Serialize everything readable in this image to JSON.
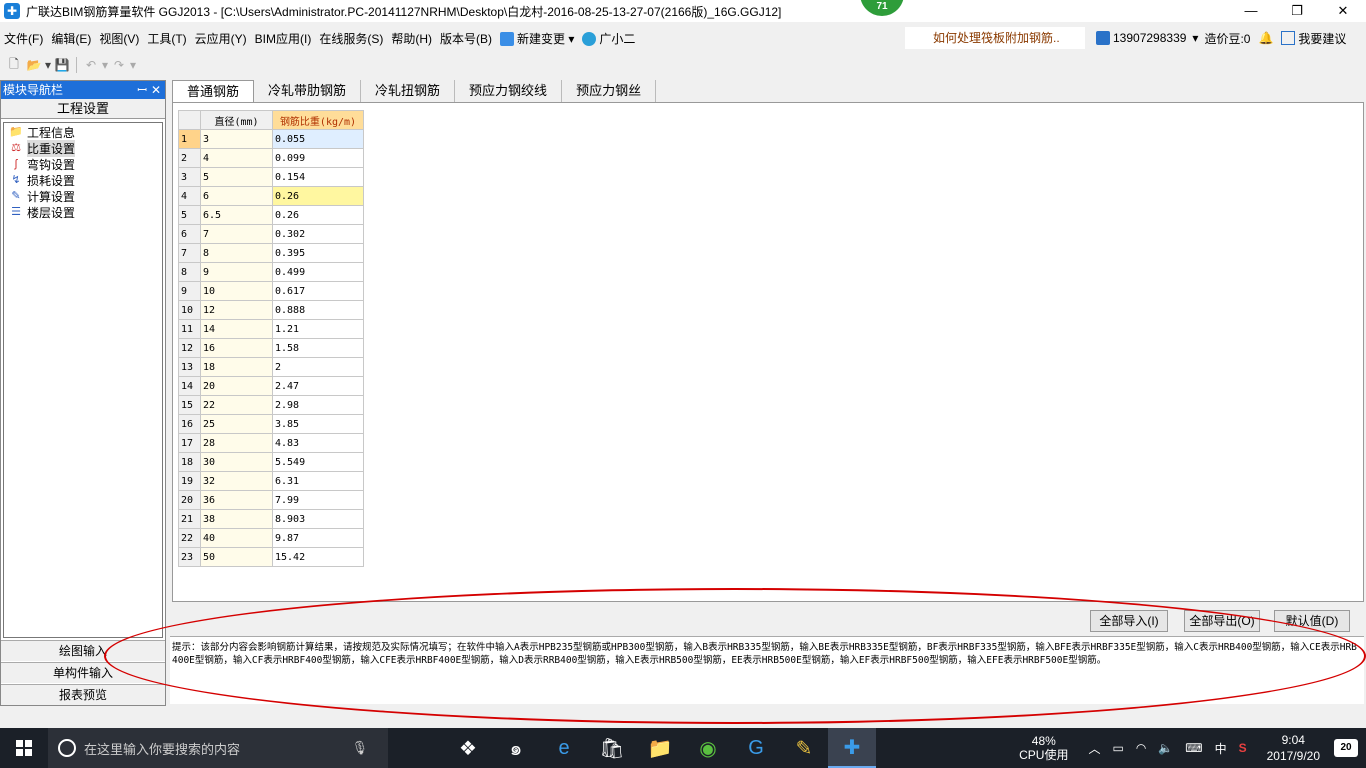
{
  "window": {
    "title": "广联达BIM钢筋算量软件 GGJ2013 - [C:\\Users\\Administrator.PC-20141127NRHM\\Desktop\\白龙村-2016-08-25-13-27-07(2166版)_16G.GGJ12]",
    "badge": "71",
    "minimize": "—",
    "maximize": "❐",
    "close": "✕"
  },
  "menu": {
    "items": [
      "文件(F)",
      "编辑(E)",
      "视图(V)",
      "工具(T)",
      "云应用(Y)",
      "BIM应用(I)",
      "在线服务(S)",
      "帮助(H)",
      "版本号(B)"
    ],
    "new_change": "新建变更",
    "guangxiaoer": "广小二",
    "question": "如何处理筏板附加钢筋..",
    "phone": "13907298339",
    "coins": "造价豆:0",
    "suggest": "我要建议"
  },
  "nav": {
    "title": "模块导航栏",
    "pin": "ꟷ",
    "close": "✕",
    "section": "工程设置",
    "items": [
      {
        "label": "工程信息",
        "icon": "project-info-icon"
      },
      {
        "label": "比重设置",
        "icon": "weight-settings-icon"
      },
      {
        "label": "弯钩设置",
        "icon": "hook-settings-icon"
      },
      {
        "label": "损耗设置",
        "icon": "loss-settings-icon"
      },
      {
        "label": "计算设置",
        "icon": "calc-settings-icon"
      },
      {
        "label": "楼层设置",
        "icon": "floor-settings-icon"
      }
    ],
    "bottom": [
      "绘图输入",
      "单构件输入",
      "报表预览"
    ]
  },
  "tabs": [
    "普通钢筋",
    "冷轧带肋钢筋",
    "冷轧扭钢筋",
    "预应力钢绞线",
    "预应力钢丝"
  ],
  "table": {
    "headers": [
      "直径(mm)",
      "钢筋比重(kg/m)"
    ],
    "rows": [
      [
        "3",
        "0.055"
      ],
      [
        "4",
        "0.099"
      ],
      [
        "5",
        "0.154"
      ],
      [
        "6",
        "0.26"
      ],
      [
        "6.5",
        "0.26"
      ],
      [
        "7",
        "0.302"
      ],
      [
        "8",
        "0.395"
      ],
      [
        "9",
        "0.499"
      ],
      [
        "10",
        "0.617"
      ],
      [
        "12",
        "0.888"
      ],
      [
        "14",
        "1.21"
      ],
      [
        "16",
        "1.58"
      ],
      [
        "18",
        "2"
      ],
      [
        "20",
        "2.47"
      ],
      [
        "22",
        "2.98"
      ],
      [
        "25",
        "3.85"
      ],
      [
        "28",
        "4.83"
      ],
      [
        "30",
        "5.549"
      ],
      [
        "32",
        "6.31"
      ],
      [
        "36",
        "7.99"
      ],
      [
        "38",
        "8.903"
      ],
      [
        "40",
        "9.87"
      ],
      [
        "50",
        "15.42"
      ]
    ]
  },
  "buttons": {
    "import_all": "全部导入(I)",
    "export_all": "全部导出(O)",
    "default": "默认值(D)"
  },
  "hint": "提示：该部分内容会影响钢筋计算结果，请按规范及实际情况填写；在软件中输入A表示HPB235型钢筋或HPB300型钢筋，输入B表示HRB335型钢筋，输入BE表示HRB335E型钢筋，BF表示HRBF335型钢筋，输入BFE表示HRBF335E型钢筋，输入C表示HRB400型钢筋，输入CE表示HRB400E型钢筋，输入CF表示HRBF400型钢筋，输入CFE表示HRBF400E型钢筋，输入D表示RRB400型钢筋，输入E表示HRB500型钢筋，EE表示HRB500E型钢筋，输入EF表示HRBF500型钢筋，输入EFE表示HRBF500E型钢筋。",
  "taskbar": {
    "search_placeholder": "在这里输入你要搜索的内容",
    "cpu_percent": "48%",
    "cpu_label": "CPU使用",
    "ime": "中",
    "time": "9:04",
    "date": "2017/9/20",
    "notifications": "20"
  }
}
